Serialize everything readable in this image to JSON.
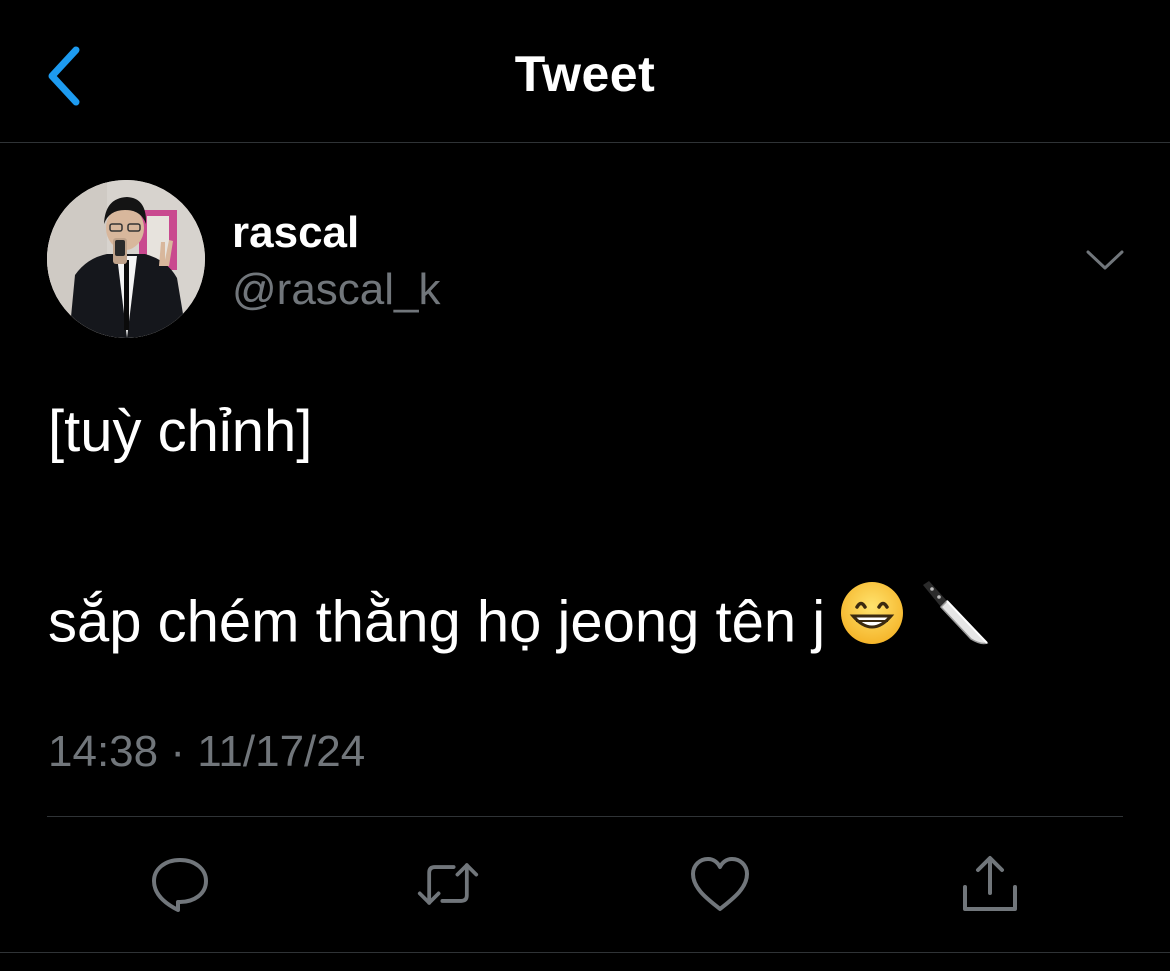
{
  "header": {
    "title": "Tweet",
    "back_icon": "chevron-left-icon",
    "accent_color": "#1d9bf0"
  },
  "author": {
    "display_name": "rascal",
    "handle": "@rascal_k",
    "avatar": "avatar-photo",
    "menu_icon": "chevron-down-icon"
  },
  "tweet": {
    "line1": "[tuỳ chỉnh]",
    "line2": "sắp chém thằng họ jeong tên j",
    "emojis": [
      "grinning-face-emoji",
      "kitchen-knife-emoji"
    ],
    "timestamp": "14:38 · 11/17/24"
  },
  "actions": {
    "reply_icon": "reply-icon",
    "retweet_icon": "retweet-icon",
    "like_icon": "heart-icon",
    "share_icon": "share-icon"
  },
  "colors": {
    "background": "#000000",
    "text_primary": "#ffffff",
    "text_secondary": "#71767b",
    "divider": "#2f3336"
  }
}
